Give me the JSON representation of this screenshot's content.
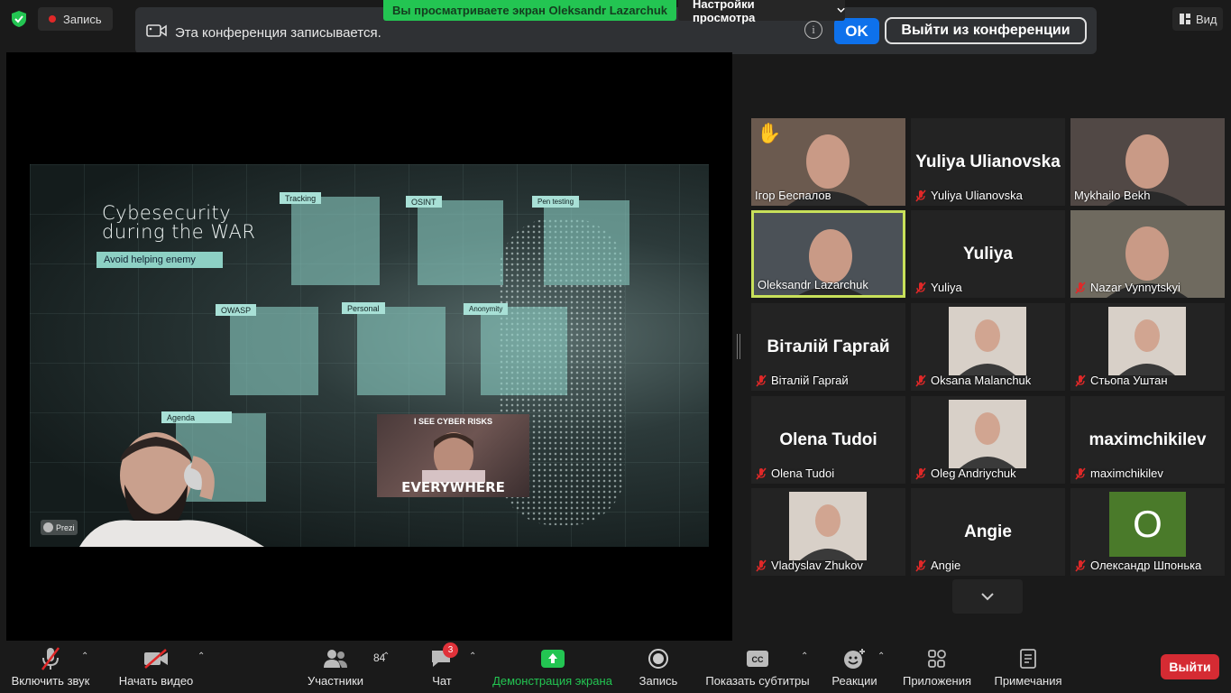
{
  "top": {
    "recording_label": "Запись",
    "share_banner": "Вы просматриваете экран Oleksandr Lazarchuk",
    "view_options": "Настройки просмотра",
    "recording_notice": "Эта конференция записывается.",
    "ok_label": "OK",
    "leave_conference_label": "Выйти из конференции",
    "view_label": "Вид"
  },
  "slide": {
    "title_line1": "Cybesecurity",
    "title_line2": "during the WAR",
    "subtitle": "Avoid helping enemy",
    "tiles": [
      "Tracking",
      "OSINT",
      "Pen testing",
      "OWASP",
      "Personal",
      "Anonymity",
      "Agenda"
    ],
    "meme_top": "I SEE CYBER RISKS",
    "meme_bottom": "EVERYWHERE",
    "prezi_label": "Prezi"
  },
  "participants": [
    {
      "name": "Ігор Беспалов",
      "big": "",
      "muted": false,
      "hand": true,
      "video": true
    },
    {
      "name": "Yuliya Ulianovska",
      "big": "Yuliya Ulianovska",
      "muted": true
    },
    {
      "name": "Mykhailo Bekh",
      "big": "",
      "muted": false,
      "video": true
    },
    {
      "name": "Oleksandr Lazarchuk",
      "big": "",
      "muted": false,
      "active": true,
      "video": true
    },
    {
      "name": "Yuliya",
      "big": "Yuliya",
      "muted": true
    },
    {
      "name": "Nazar Vynnytskyi",
      "big": "",
      "muted": true,
      "video": true
    },
    {
      "name": "Віталій Гаргай",
      "big": "Віталій Гаргай",
      "muted": true
    },
    {
      "name": "Oksana Malanchuk",
      "big": "",
      "muted": true,
      "photo": true
    },
    {
      "name": "Стьопа Уштан",
      "big": "",
      "muted": true,
      "photo": true
    },
    {
      "name": "Olena Tudoi",
      "big": "Olena Tudoi",
      "muted": true
    },
    {
      "name": "Oleg Andriychuk",
      "big": "",
      "muted": true,
      "photo": true
    },
    {
      "name": "maximchikilev",
      "big": "maximchikilev",
      "muted": true
    },
    {
      "name": "Vladyslav Zhukov",
      "big": "",
      "muted": true,
      "photo": true
    },
    {
      "name": "Angie",
      "big": "Angie",
      "muted": true
    },
    {
      "name": "Олександр Шпонька",
      "big": "",
      "muted": true,
      "initial": "O"
    }
  ],
  "toolbar": {
    "audio": "Включить звук",
    "video": "Начать видео",
    "participants": "Участники",
    "participants_count": "84",
    "chat": "Чат",
    "chat_badge": "3",
    "share": "Демонстрация экрана",
    "record": "Запись",
    "captions": "Показать субтитры",
    "reactions": "Реакции",
    "apps": "Приложения",
    "notes": "Примечания",
    "leave": "Выйти"
  },
  "colors": {
    "accent": "#0e71eb",
    "share_green": "#23c552",
    "leave_red": "#d52b33",
    "active_speaker": "#c8e05a"
  }
}
